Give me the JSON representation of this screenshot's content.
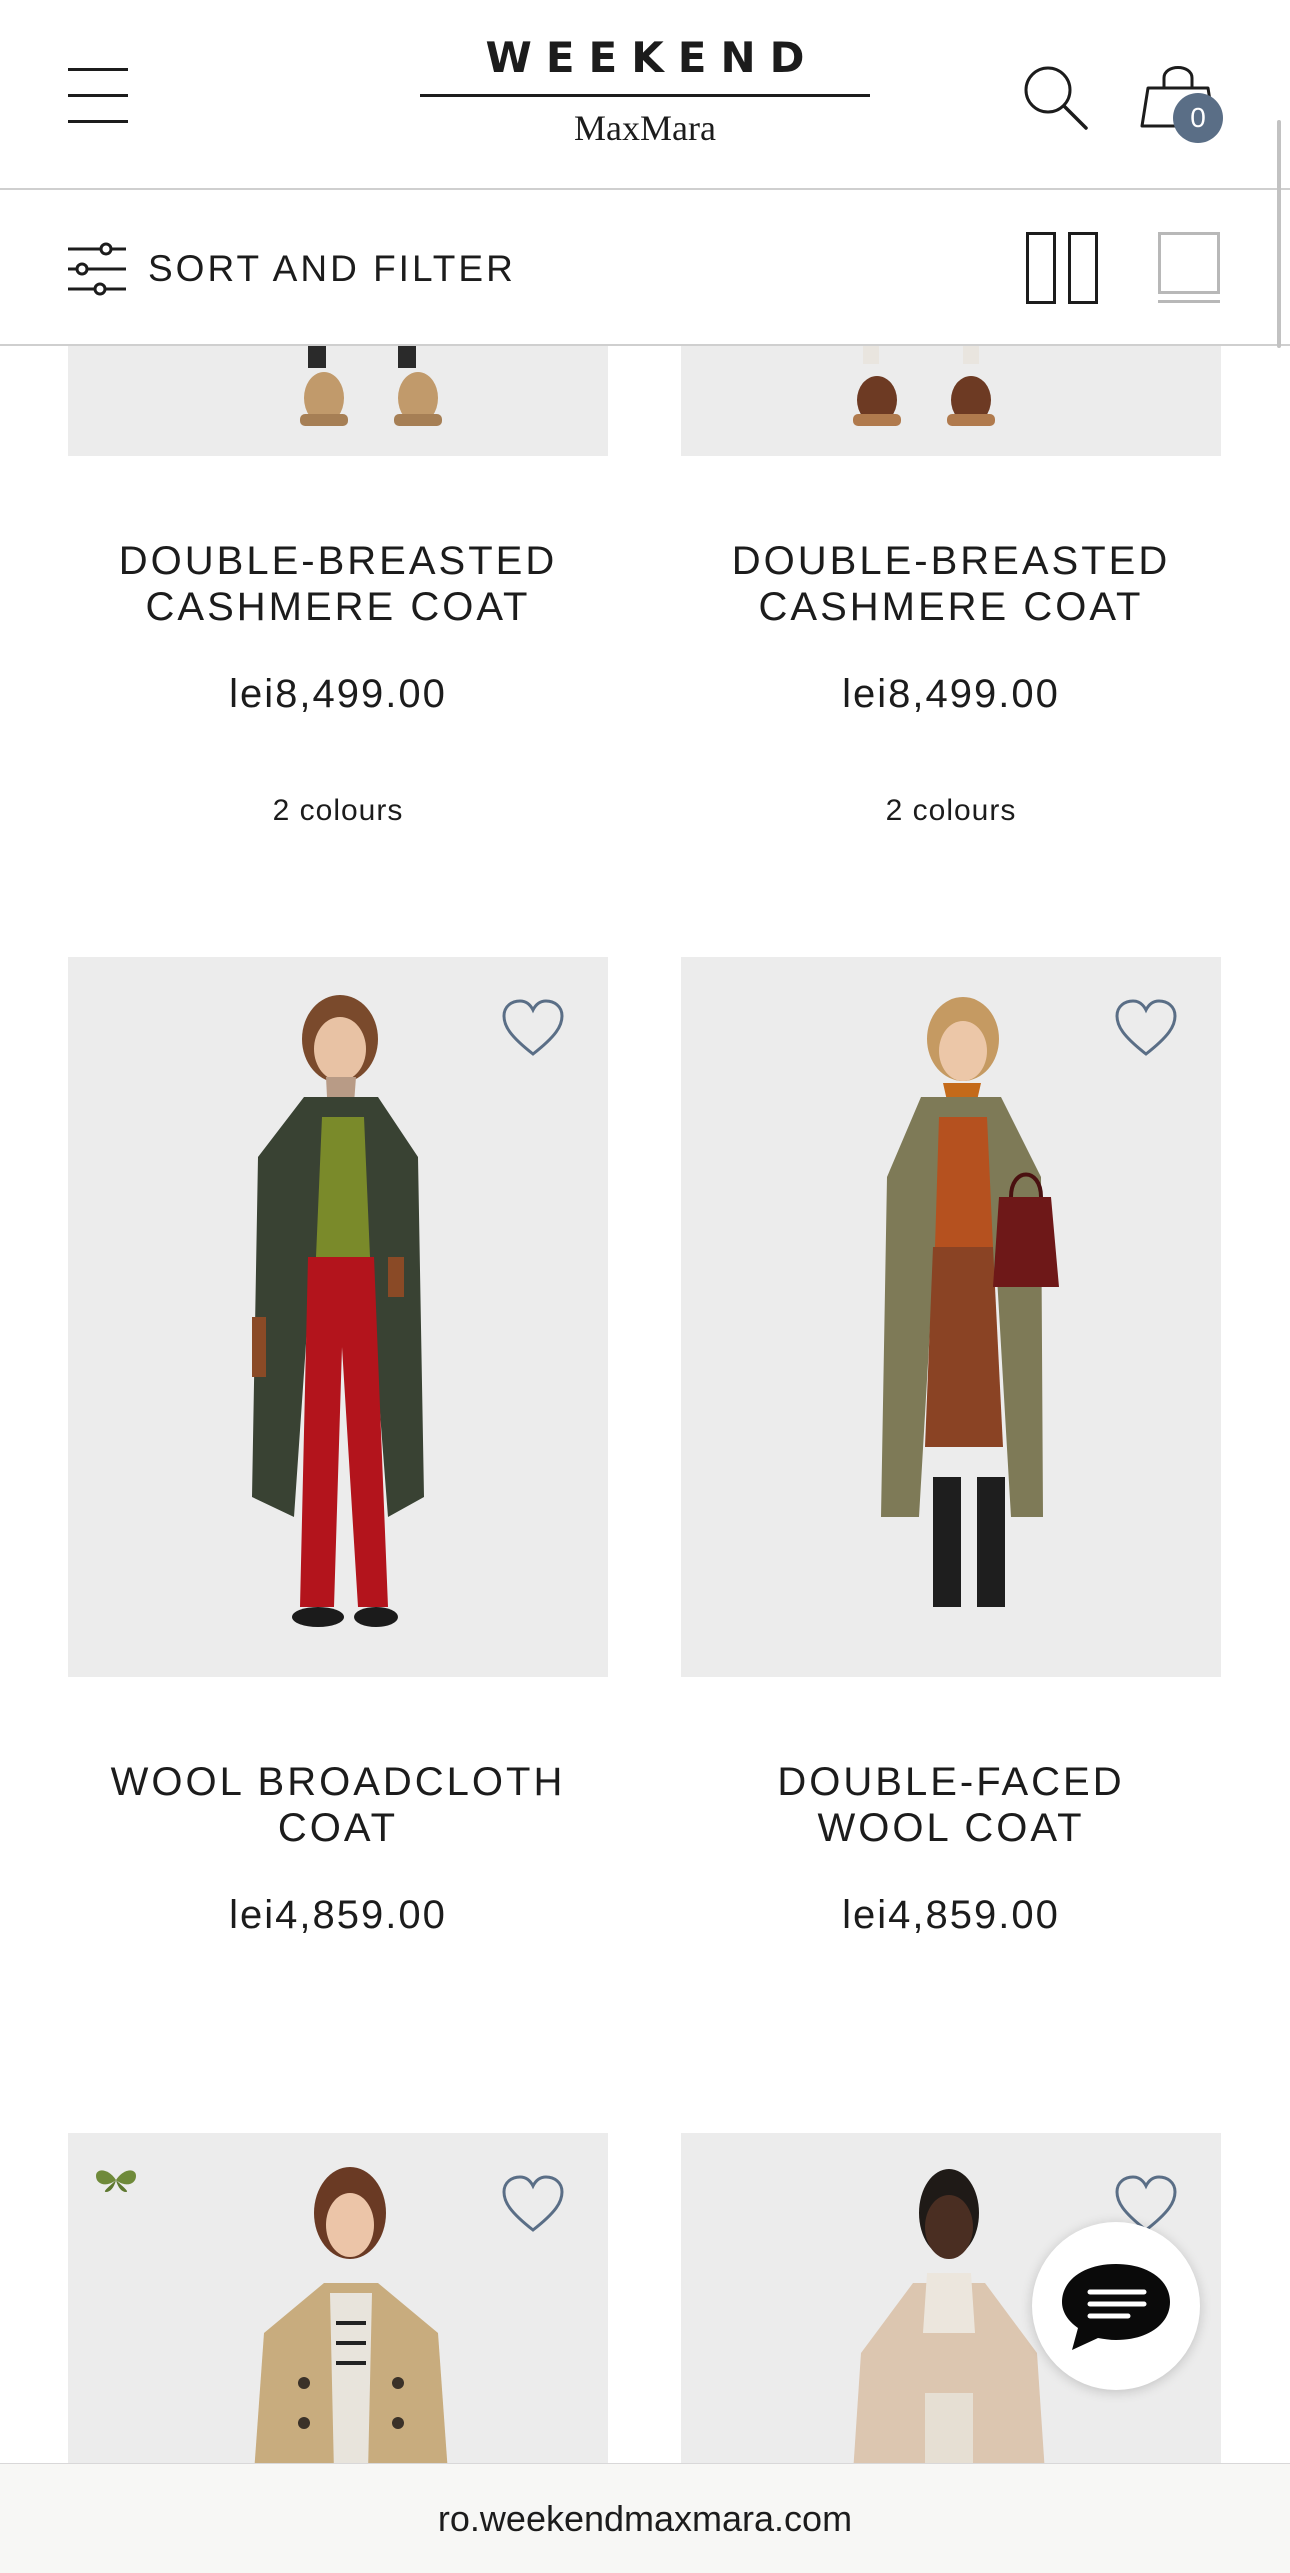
{
  "header": {
    "logo_top": "WEEKEND",
    "logo_bottom": "MaxMara",
    "cart_count": "0"
  },
  "filterbar": {
    "label": "SORT AND FILTER"
  },
  "products": [
    {
      "name_line1": "DOUBLE-BREASTED",
      "name_line2": "CASHMERE COAT",
      "price": "lei8,499.00",
      "colours": "2 colours"
    },
    {
      "name_line1": "DOUBLE-BREASTED",
      "name_line2": "CASHMERE COAT",
      "price": "lei8,499.00",
      "colours": "2 colours"
    },
    {
      "name_line1": "WOOL BROADCLOTH",
      "name_line2": "COAT",
      "price": "lei4,859.00"
    },
    {
      "name_line1": "DOUBLE-FACED",
      "name_line2": "WOOL COAT",
      "price": "lei4,859.00"
    }
  ],
  "browser": {
    "url": "ro.weekendmaxmara.com"
  },
  "colors": {
    "accent_badge": "#5a6e86",
    "image_bg": "#ececec",
    "butterfly": "#6f8a3a"
  },
  "icons": [
    "menu-icon",
    "search-icon",
    "shopping-bag-icon",
    "filter-sliders-icon",
    "grid-two-icon",
    "grid-one-icon",
    "heart-icon",
    "butterfly-icon",
    "chat-icon"
  ]
}
